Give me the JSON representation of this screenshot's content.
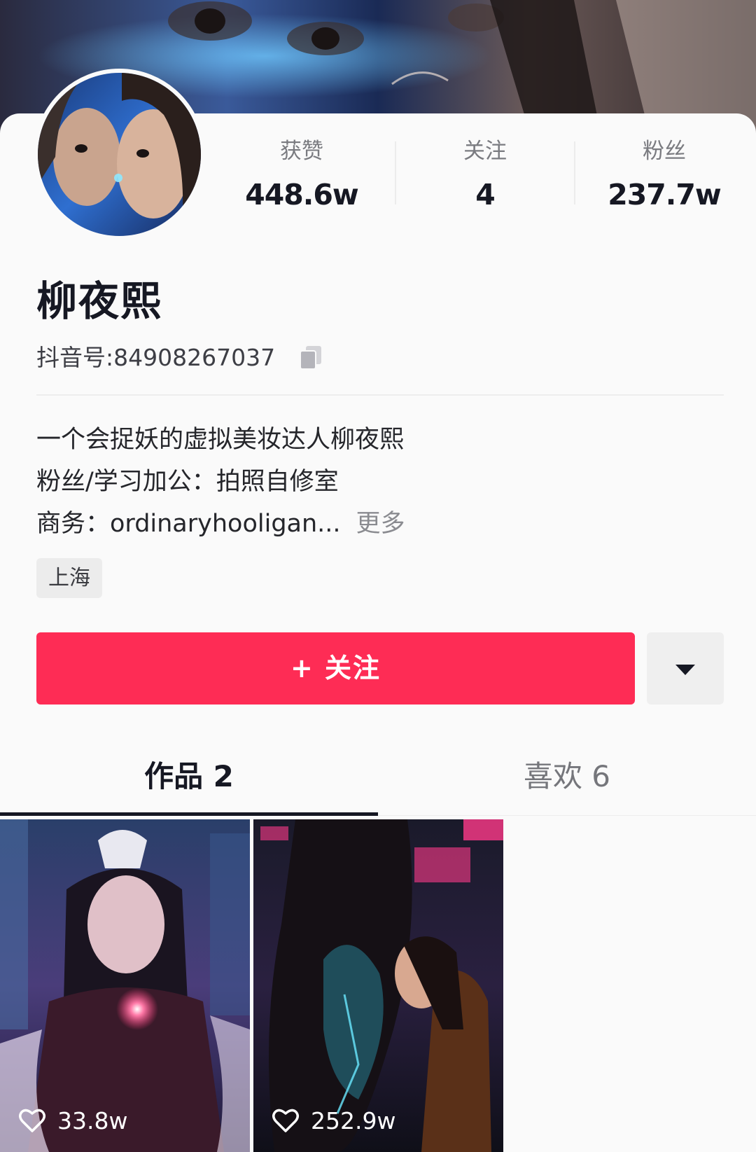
{
  "profile": {
    "name": "柳夜熙",
    "douyin_id": "抖音号:84908267037",
    "stats": [
      {
        "label": "获赞",
        "value": "448.6w"
      },
      {
        "label": "关注",
        "value": "4"
      },
      {
        "label": "粉丝",
        "value": "237.7w"
      }
    ],
    "bio": [
      "一个会捉妖的虚拟美妆达人柳夜熙",
      "粉丝/学习加公：拍照自修室",
      "商务：ordinaryhooligan..."
    ],
    "more_label": "更多",
    "location": "上海"
  },
  "actions": {
    "follow_label": "+ 关注"
  },
  "tabs": [
    {
      "label": "作品 2",
      "active": true
    },
    {
      "label": "喜欢 6",
      "active": false
    }
  ],
  "videos": [
    {
      "likes": "33.8w"
    },
    {
      "likes": "252.9w"
    }
  ],
  "colors": {
    "accent": "#fe2c55",
    "background": "#fafafa",
    "text": "#161823",
    "muted": "#7a7b80"
  },
  "icons": [
    "copy-icon",
    "chevron-down-icon",
    "heart-icon"
  ]
}
